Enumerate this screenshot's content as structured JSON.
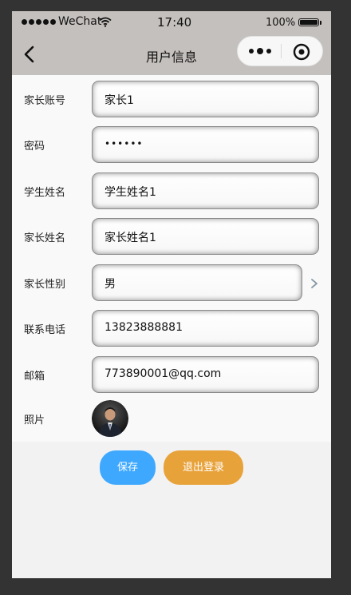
{
  "status_bar": {
    "carrier": "WeChat",
    "time": "17:40",
    "battery": "100%"
  },
  "nav": {
    "title": "用户信息",
    "back_icon": "chevron-left-icon",
    "more_icon": "more-dots-icon",
    "close_icon": "target-circle-icon"
  },
  "form": {
    "parent_account": {
      "label": "家长账号",
      "value": "家长1"
    },
    "password": {
      "label": "密码",
      "value": "••••••"
    },
    "student_name": {
      "label": "学生姓名",
      "value": "学生姓名1"
    },
    "parent_name": {
      "label": "家长姓名",
      "value": "家长姓名1"
    },
    "parent_gender": {
      "label": "家长性别",
      "value": "男"
    },
    "phone": {
      "label": "联系电话",
      "value": "13823888881"
    },
    "email": {
      "label": "邮箱",
      "value": "773890001@qq.com"
    },
    "photo": {
      "label": "照片"
    }
  },
  "buttons": {
    "save": "保存",
    "logout": "退出登录"
  },
  "colors": {
    "save_button": "#3ea8ff",
    "logout_button": "#e8a23a",
    "navbar": "#c4c0bd"
  }
}
